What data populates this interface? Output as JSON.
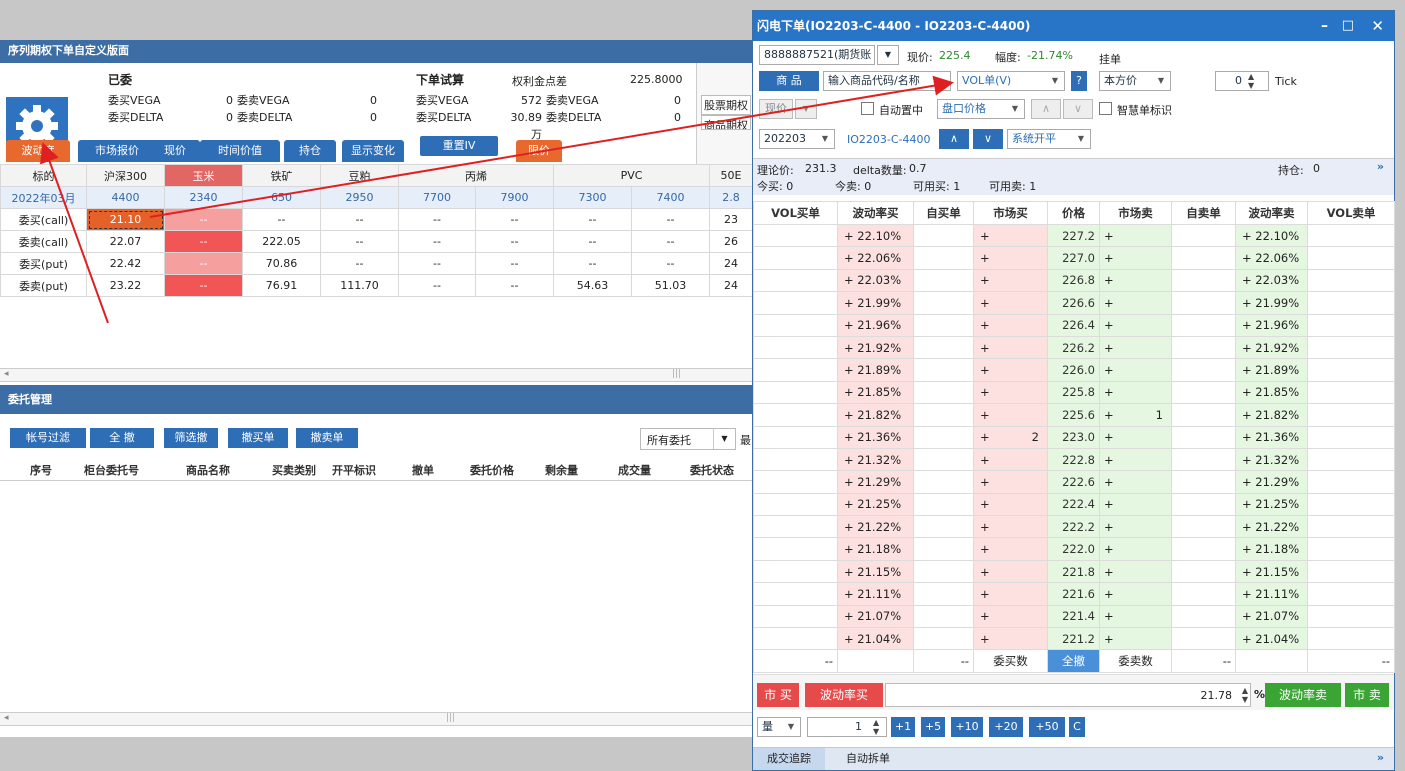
{
  "left": {
    "title": "序列期权下单自定义版面",
    "summary": {
      "group1": "已委",
      "vega_buy_l": "委买VEGA",
      "vega_buy_v": "0",
      "vega_sell_l": "委卖VEGA",
      "vega_sell_v": "0",
      "delta_buy_l": "委买DELTA",
      "delta_buy_v": "0",
      "delta_sell_l": "委卖DELTA",
      "delta_sell_v": "0",
      "group2": "下单试算",
      "spread_l": "权利金点差",
      "spread_v": "225.8000",
      "t_vega_buy_v": "572",
      "t_delta_buy_v": "30.89万",
      "t_vega_sell_v": "0",
      "t_delta_sell_v": "0",
      "side1": "股票期权",
      "side2": "商品期权"
    },
    "tabs": [
      "波动度",
      "市场报价",
      "现价",
      "时间价值",
      "持仓",
      "显示变化",
      "重置IV",
      "限价"
    ],
    "grid_header": [
      "标的",
      "沪深300",
      "玉米",
      "铁矿",
      "豆粕",
      "丙烯",
      "",
      "PVC",
      "",
      "50E"
    ],
    "grid_dates": [
      "2022年03月",
      "4400",
      "2340",
      "650",
      "2950",
      "7700",
      "7900",
      "7300",
      "7400",
      "2.8"
    ],
    "grid_rows": [
      [
        "委买(call)",
        "21.10",
        "--",
        "--",
        "--",
        "--",
        "--",
        "--",
        "--",
        "23"
      ],
      [
        "委卖(call)",
        "22.07",
        "--",
        "222.05",
        "--",
        "--",
        "--",
        "--",
        "--",
        "26"
      ],
      [
        "委买(put)",
        "22.42",
        "--",
        "70.86",
        "--",
        "--",
        "--",
        "--",
        "--",
        "24"
      ],
      [
        "委卖(put)",
        "23.22",
        "--",
        "76.91",
        "111.70",
        "--",
        "--",
        "54.63",
        "51.03",
        "24"
      ]
    ],
    "order_title": "委托管理",
    "order_buttons": [
      "帐号过滤",
      "全 撤",
      "筛选撤",
      "撤买单",
      "撤卖单"
    ],
    "order_filter": "所有委托",
    "order_filter_tail": "最",
    "order_headers": [
      "序号",
      "柜台委托号",
      "商品名称",
      "买卖类别",
      "开平标识",
      "撤单",
      "委托价格",
      "剩余量",
      "成交量",
      "委托状态"
    ]
  },
  "right": {
    "title": "闪电下单(IO2203-C-4400 - IO2203-C-4400)",
    "window_btns": [
      "–",
      "□",
      "✕"
    ],
    "account": "8888887521(期货账",
    "price_label": "现价:",
    "price_value": "225.4",
    "range_label": "幅度:",
    "range_value": "-21.74%",
    "pending": "挂单",
    "product_btn": "商 品",
    "product_input": "输入商品代码/名称",
    "order_type": "VOL单(V)",
    "help": "?",
    "side_price": "本方价",
    "tick_value": "0",
    "tick_label": "Tick",
    "cur_price": "现价",
    "auto_top": "自动置中",
    "depth_price": "盘口价格",
    "smart_mark": "智慧单标识",
    "month": "202203",
    "contract": "IO2203-C-4400",
    "openclose": "系统开平",
    "theory_l": "理论价:",
    "theory_v": "231.3",
    "delta_l": "delta数量:",
    "delta_v": "0.7",
    "pos_l": "持仓:",
    "pos_v": "0",
    "today_buy": "今买: 0",
    "today_sell": "今卖: 0",
    "avail_buy": "可用买: 1",
    "avail_sell": "可用卖: 1",
    "ob_headers": [
      "VOL买单",
      "波动率买",
      "自买单",
      "市场买",
      "价格",
      "市场卖",
      "自卖单",
      "波动率卖",
      "VOL卖单"
    ],
    "ob_rows": [
      {
        "bv": "22.10%",
        "mb": "",
        "p": "227.2",
        "ms": "",
        "sv": "22.10%"
      },
      {
        "bv": "22.06%",
        "mb": "",
        "p": "227.0",
        "ms": "",
        "sv": "22.06%"
      },
      {
        "bv": "22.03%",
        "mb": "",
        "p": "226.8",
        "ms": "",
        "sv": "22.03%"
      },
      {
        "bv": "21.99%",
        "mb": "",
        "p": "226.6",
        "ms": "",
        "sv": "21.99%"
      },
      {
        "bv": "21.96%",
        "mb": "",
        "p": "226.4",
        "ms": "",
        "sv": "21.96%"
      },
      {
        "bv": "21.92%",
        "mb": "",
        "p": "226.2",
        "ms": "",
        "sv": "21.92%"
      },
      {
        "bv": "21.89%",
        "mb": "",
        "p": "226.0",
        "ms": "",
        "sv": "21.89%"
      },
      {
        "bv": "21.85%",
        "mb": "",
        "p": "225.8",
        "ms": "",
        "sv": "21.85%"
      },
      {
        "bv": "21.82%",
        "mb": "",
        "p": "225.6",
        "ms": "1",
        "sv": "21.82%"
      },
      {
        "bv": "21.36%",
        "mb": "2",
        "p": "223.0",
        "ms": "",
        "sv": "21.36%"
      },
      {
        "bv": "21.32%",
        "mb": "",
        "p": "222.8",
        "ms": "",
        "sv": "21.32%"
      },
      {
        "bv": "21.29%",
        "mb": "",
        "p": "222.6",
        "ms": "",
        "sv": "21.29%"
      },
      {
        "bv": "21.25%",
        "mb": "",
        "p": "222.4",
        "ms": "",
        "sv": "21.25%"
      },
      {
        "bv": "21.22%",
        "mb": "",
        "p": "222.2",
        "ms": "",
        "sv": "21.22%"
      },
      {
        "bv": "21.18%",
        "mb": "",
        "p": "222.0",
        "ms": "",
        "sv": "21.18%"
      },
      {
        "bv": "21.15%",
        "mb": "",
        "p": "221.8",
        "ms": "",
        "sv": "21.15%"
      },
      {
        "bv": "21.11%",
        "mb": "",
        "p": "221.6",
        "ms": "",
        "sv": "21.11%"
      },
      {
        "bv": "21.07%",
        "mb": "",
        "p": "221.4",
        "ms": "",
        "sv": "21.07%"
      },
      {
        "bv": "21.04%",
        "mb": "",
        "p": "221.2",
        "ms": "",
        "sv": "21.04%"
      }
    ],
    "foot": {
      "c1": "--",
      "c3": "--",
      "buy_count": "委买数",
      "cancel_all": "全撤",
      "sell_count": "委卖数",
      "c7": "--",
      "c9": "--"
    },
    "market_buy": "市 买",
    "vol_buy": "波动率买",
    "vol_value": "21.78",
    "pct": "%",
    "vol_sell": "波动率卖",
    "market_sell": "市 卖",
    "qty_label": "量",
    "qty_value": "1",
    "qty_btns": [
      "+1",
      "+5",
      "+10",
      "+20",
      "+50",
      "C"
    ],
    "bottom_tabs": [
      "成交追踪",
      "自动拆单"
    ]
  },
  "colors": {
    "accent": "#2d6eb6",
    "orange": "#e8692e",
    "red": "#e54b4b",
    "green": "#3aa435",
    "arrow": "#e02020"
  }
}
